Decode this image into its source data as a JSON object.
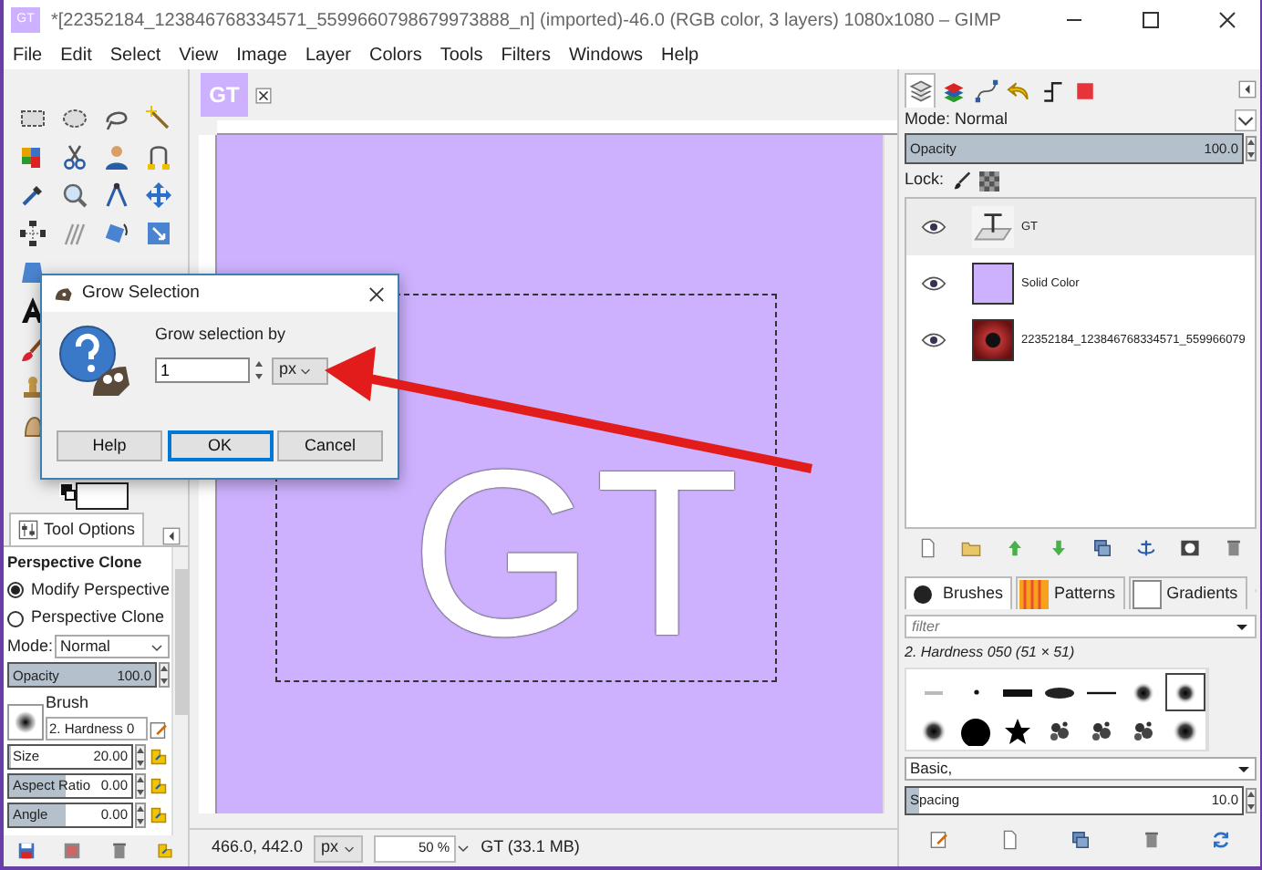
{
  "window": {
    "title": "*[22352184_123846768334571_5599660798679973888_n] (imported)-46.0 (RGB color, 3 layers) 1080x1080 – GIMP",
    "app_icon": "GT"
  },
  "menu": [
    "File",
    "Edit",
    "Select",
    "View",
    "Image",
    "Layer",
    "Colors",
    "Tools",
    "Filters",
    "Windows",
    "Help"
  ],
  "image_tab": {
    "thumbnail": "GT"
  },
  "tool_options": {
    "tab": "Tool Options",
    "title": "Perspective Clone",
    "radios": [
      {
        "label": "Modify Perspective",
        "selected": true
      },
      {
        "label": "Perspective Clone",
        "selected": false
      }
    ],
    "mode": {
      "label": "Mode:",
      "value": "Normal"
    },
    "opacity": {
      "label": "Opacity",
      "reading": "100.0",
      "level": 1
    },
    "brush": {
      "label": "Brush",
      "value": "2. Hardness 0"
    },
    "sliders": [
      {
        "label": "Size",
        "reading": "20.00",
        "level": 0.02
      },
      {
        "label": "Aspect Ratio",
        "reading": "0.00",
        "level": 0.47
      },
      {
        "label": "Angle",
        "reading": "0.00",
        "level": 0.47
      }
    ]
  },
  "dialog": {
    "title": "Grow Selection",
    "label": "Grow selection by",
    "value": "1",
    "unit": "px",
    "buttons": [
      {
        "label": "Help",
        "default": false
      },
      {
        "label": "OK",
        "default": true
      },
      {
        "label": "Cancel",
        "default": false
      }
    ]
  },
  "canvas": {
    "text": "GT"
  },
  "status_bar": {
    "coords": "466.0, 442.0",
    "unit": "px",
    "zoom": "50 %",
    "info": "GT (33.1 MB)"
  },
  "layers_panel": {
    "dock_tabs": [
      {
        "kind": "layers",
        "selected": true
      },
      {
        "kind": "channels",
        "selected": false
      },
      {
        "kind": "paths",
        "selected": false
      },
      {
        "kind": "undo",
        "selected": false
      },
      {
        "kind": "pointer",
        "selected": false
      },
      {
        "kind": "color",
        "selected": false
      }
    ],
    "mode": {
      "label": "Mode: Normal"
    },
    "opacity": {
      "label": "Opacity",
      "reading": "100.0",
      "level": 1
    },
    "lock_label": "Lock:",
    "layers": [
      {
        "name": "GT",
        "kind": "text",
        "selected": true
      },
      {
        "name": "Solid Color",
        "kind": "color",
        "selected": false
      },
      {
        "name": "22352184_123846768334571_559966079",
        "kind": "image",
        "selected": false
      }
    ]
  },
  "brushes_panel": {
    "tabs": [
      {
        "label": "Brushes",
        "selected": true
      },
      {
        "label": "Patterns",
        "selected": false
      },
      {
        "label": "Gradients",
        "selected": false
      }
    ],
    "filter_placeholder": "filter",
    "brush_name": "2. Hardness 050 (51 × 51)",
    "brushes": [
      {
        "kind": "tiny",
        "selected": false
      },
      {
        "kind": "dot",
        "selected": false
      },
      {
        "kind": "bar",
        "selected": false
      },
      {
        "kind": "ellipse",
        "selected": false
      },
      {
        "kind": "line",
        "selected": false
      },
      {
        "kind": "soft",
        "selected": false
      },
      {
        "kind": "soft",
        "selected": true
      },
      {
        "kind": "fuzzy",
        "selected": false
      },
      {
        "kind": "round",
        "selected": false
      },
      {
        "kind": "star",
        "selected": false
      },
      {
        "kind": "splatter",
        "selected": false
      },
      {
        "kind": "splatter",
        "selected": false
      },
      {
        "kind": "splatter",
        "selected": false
      },
      {
        "kind": "fuzzy",
        "selected": false
      }
    ],
    "set": "Basic,",
    "spacing": {
      "label": "Spacing",
      "reading": "10.0",
      "level": 0.04
    }
  }
}
